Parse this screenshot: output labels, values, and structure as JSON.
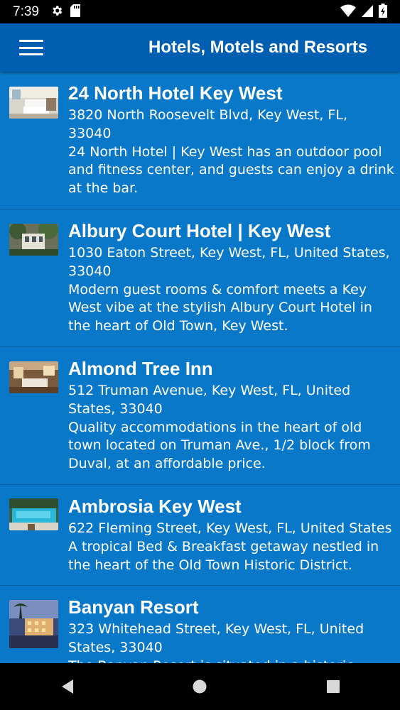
{
  "status_bar": {
    "time": "7:39",
    "icons_left": [
      "gear-icon",
      "sd-card-icon"
    ],
    "icons_right": [
      "wifi-icon",
      "cell-signal-icon",
      "battery-charging-icon"
    ]
  },
  "app_bar": {
    "title": "Hotels, Motels and Resorts",
    "menu_icon": "hamburger-menu-icon"
  },
  "colors": {
    "background": "#0a78c8",
    "app_bar": "#005fb0",
    "divider": "#0a5f9e",
    "text": "#ffffff"
  },
  "listings": [
    {
      "name": "24 North Hotel Key West",
      "address_lines": [
        "3820 North Roosevelt Blvd, Key West, FL,",
        "33040"
      ],
      "description_lines": [
        "24 North Hotel | Key West has an outdoor pool",
        "and fitness center, and guests can enjoy a drink",
        "at the bar."
      ]
    },
    {
      "name": "Albury Court Hotel | Key West",
      "address_lines": [
        "1030 Eaton Street, Key West, FL, United States,",
        "33040"
      ],
      "description_lines": [
        "Modern guest rooms & comfort meets a Key",
        "West vibe at the stylish Albury Court Hotel in",
        "the heart of Old Town, Key West."
      ]
    },
    {
      "name": "Almond Tree Inn",
      "address_lines": [
        "512 Truman Avenue, Key West, FL, United",
        "States, 33040"
      ],
      "description_lines": [
        "Quality accommodations in the heart of old",
        "town located on Truman Ave., 1/2 block from",
        "Duval, at an affordable price."
      ]
    },
    {
      "name": "Ambrosia Key West",
      "address_lines": [
        "622 Fleming Street, Key West, FL, United States"
      ],
      "description_lines": [
        "A tropical Bed & Breakfast getaway nestled in",
        "the heart of the Old Town Historic District."
      ]
    },
    {
      "name": "Banyan Resort",
      "address_lines": [
        "323 Whitehead Street, Key West, FL, United",
        "States, 33040"
      ],
      "description_lines": [
        "The Banyan Resort is situated in a historic"
      ]
    }
  ],
  "nav_bar": {
    "icons": [
      "back-icon",
      "home-icon",
      "recents-icon"
    ]
  }
}
